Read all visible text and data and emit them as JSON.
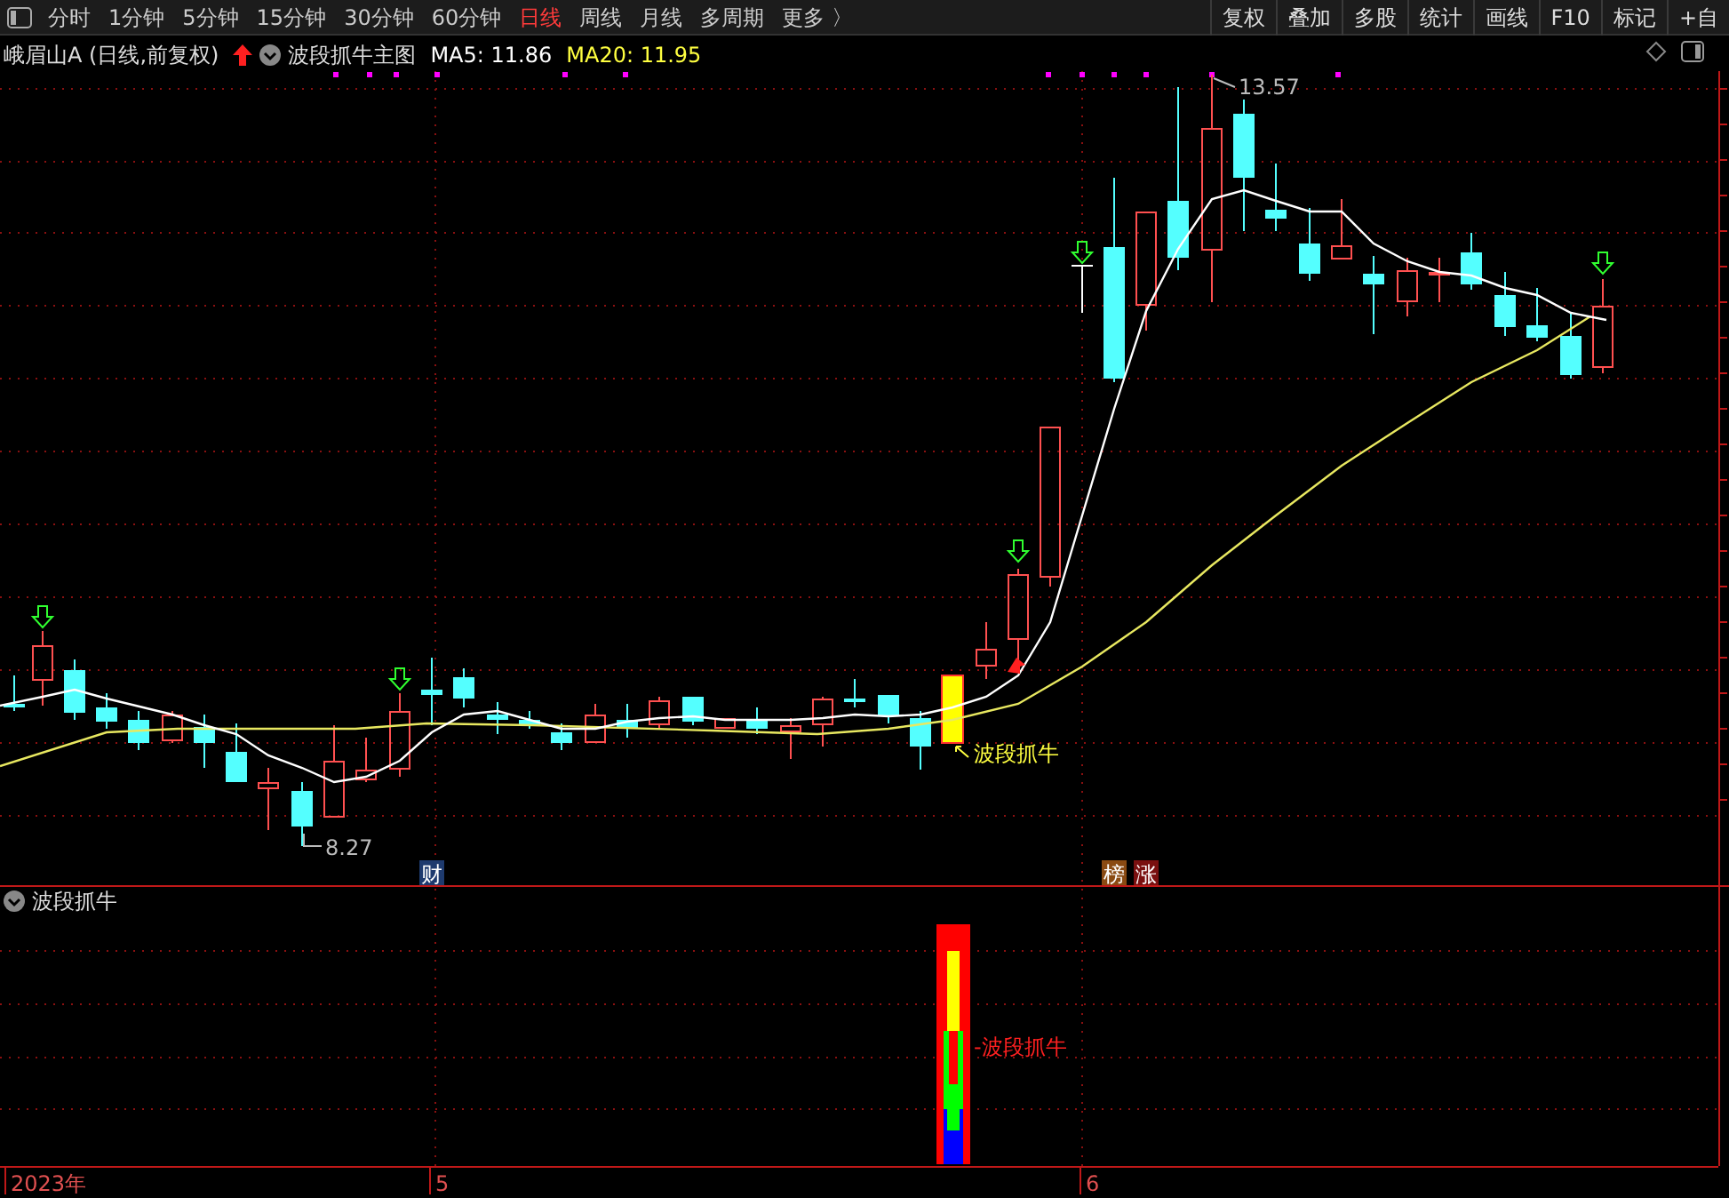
{
  "toolbar": {
    "periods": [
      {
        "label": "分时",
        "selected": false
      },
      {
        "label": "1分钟",
        "selected": false
      },
      {
        "label": "5分钟",
        "selected": false
      },
      {
        "label": "15分钟",
        "selected": false
      },
      {
        "label": "30分钟",
        "selected": false
      },
      {
        "label": "60分钟",
        "selected": false
      },
      {
        "label": "日线",
        "selected": true
      },
      {
        "label": "周线",
        "selected": false
      },
      {
        "label": "月线",
        "selected": false
      },
      {
        "label": "多周期",
        "selected": false
      },
      {
        "label": "更多 〉",
        "selected": false
      }
    ],
    "buttons": [
      "复权",
      "叠加",
      "多股",
      "统计",
      "画线",
      "F10",
      "标记",
      "+自"
    ]
  },
  "main_chart": {
    "stock": "峨眉山A (日线,前复权)",
    "indicator": "波段抓牛主图",
    "ma5": "MA5: 11.86",
    "ma20": "MA20: 11.95",
    "high_label": "13.57",
    "low_label": "8.27",
    "signal_label": "波段抓牛",
    "badges": [
      {
        "text": "财",
        "color": "#1e3a6e"
      },
      {
        "text": "榜",
        "color": "#8a4a12"
      },
      {
        "text": "涨",
        "color": "#7a1010"
      }
    ]
  },
  "sub_chart": {
    "title": "波段抓牛",
    "signal_label": "-波段抓牛"
  },
  "x_axis": [
    "2023年",
    "5",
    "6"
  ]
}
